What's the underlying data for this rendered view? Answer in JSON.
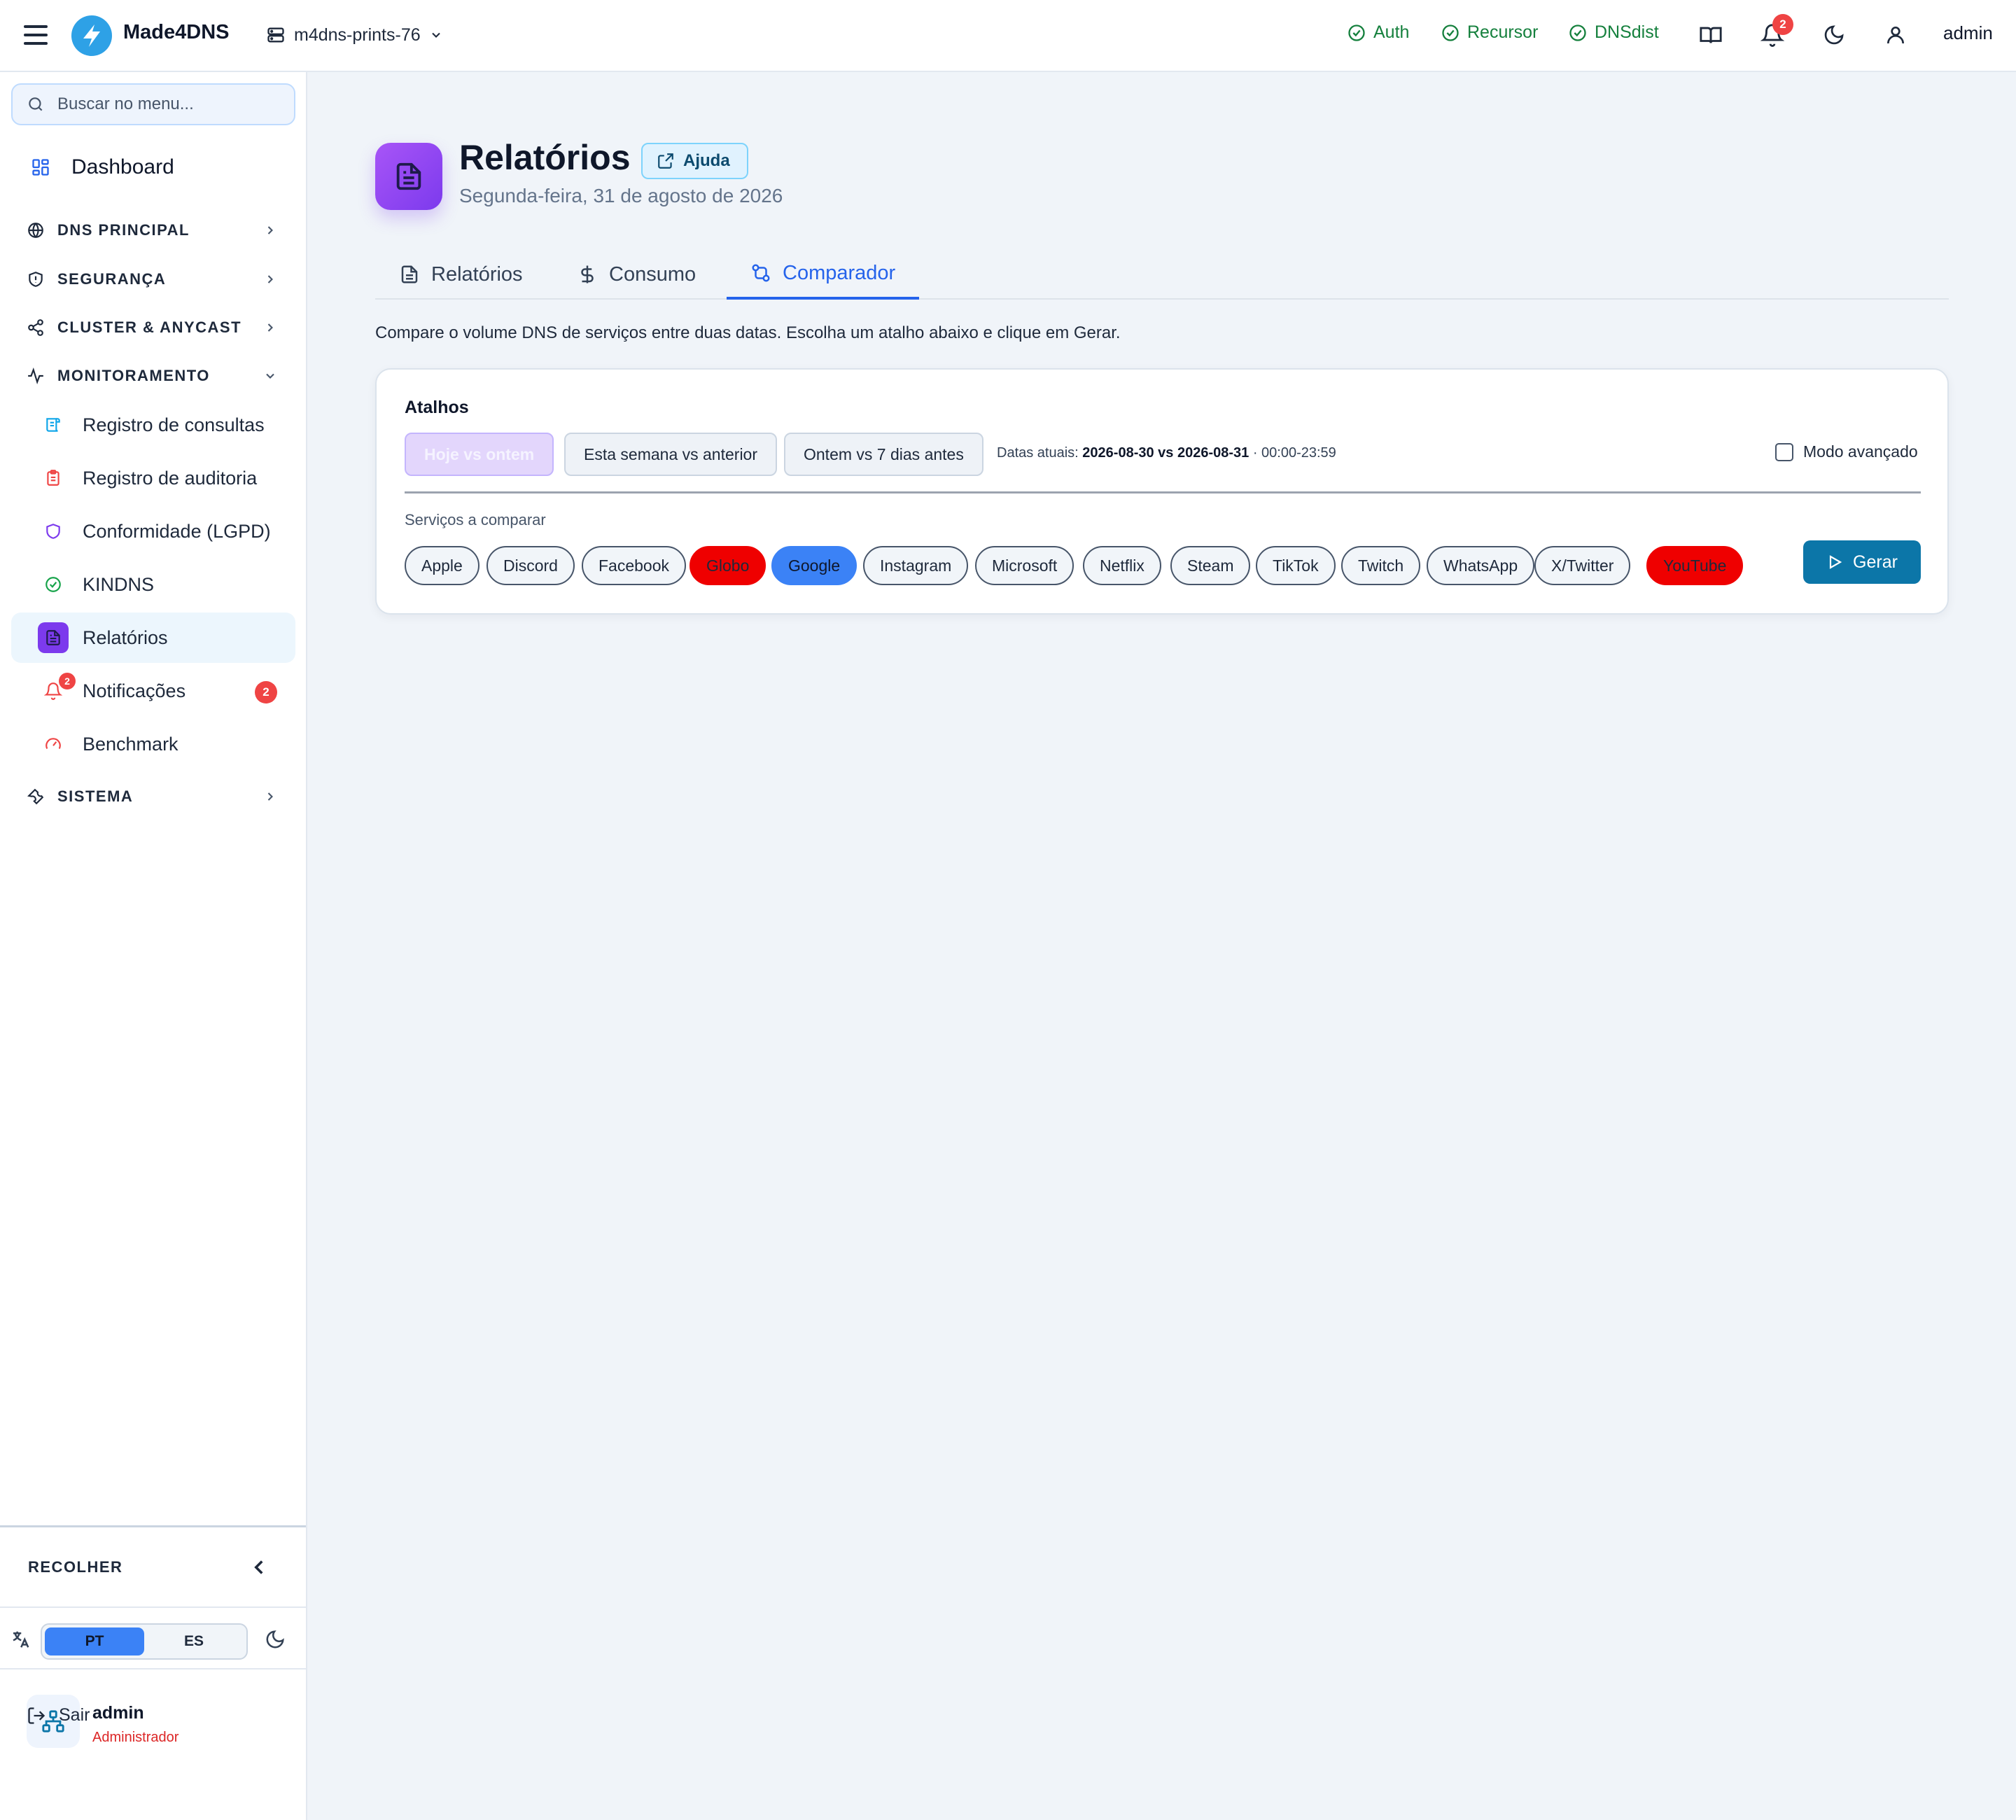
{
  "topbar": {
    "brand": "Made4DNS",
    "server": "m4dns-prints-76",
    "status": [
      {
        "label": "Auth",
        "color": "#15803d"
      },
      {
        "label": "Recursor",
        "color": "#15803d"
      },
      {
        "label": "DNSdist",
        "color": "#15803d"
      }
    ],
    "notifications_count": "2",
    "user": "admin"
  },
  "sidebar": {
    "search_placeholder": "Buscar no menu...",
    "dashboard": "Dashboard",
    "sections": [
      {
        "label": "DNS PRINCIPAL",
        "icon": "globe-icon",
        "expanded": false
      },
      {
        "label": "SEGURANÇA",
        "icon": "shield-alert-icon",
        "expanded": false
      },
      {
        "label": "CLUSTER & ANYCAST",
        "icon": "share-nodes-icon",
        "expanded": false
      },
      {
        "label": "MONITORAMENTO",
        "icon": "activity-icon",
        "expanded": true
      },
      {
        "label": "SISTEMA",
        "icon": "wrench-icon",
        "expanded": false
      }
    ],
    "monitor_items": [
      {
        "label": "Registro de consultas",
        "icon": "scroll-icon",
        "color": "#0ea5e9"
      },
      {
        "label": "Registro de auditoria",
        "icon": "clipboard-icon",
        "color": "#ef4444"
      },
      {
        "label": "Conformidade (LGPD)",
        "icon": "shield-icon",
        "color": "#7c3aed"
      },
      {
        "label": "KINDNS",
        "icon": "check-circle-icon",
        "color": "#16a34a"
      },
      {
        "label": "Relatórios",
        "icon": "file-text-icon",
        "color": "#7c3aed",
        "active": true
      },
      {
        "label": "Notificações",
        "icon": "bell-icon",
        "color": "#ef4444",
        "badge": "2"
      },
      {
        "label": "Benchmark",
        "icon": "gauge-icon",
        "color": "#ef4444"
      }
    ],
    "collapse": "RECOLHER",
    "languages": [
      "PT",
      "ES"
    ],
    "active_language": "PT",
    "user": {
      "name": "admin",
      "role": "Administrador"
    },
    "logout": "Sair"
  },
  "page": {
    "title": "Relatórios",
    "help": "Ajuda",
    "subtitle": "Segunda-feira, 31 de agosto de 2026",
    "tabs": [
      {
        "label": "Relatórios",
        "icon": "file-text-icon"
      },
      {
        "label": "Consumo",
        "icon": "dollar-icon"
      },
      {
        "label": "Comparador",
        "icon": "git-compare-icon",
        "active": true
      }
    ],
    "description": "Compare o volume DNS de serviços entre duas datas. Escolha um atalho abaixo e clique em Gerar."
  },
  "comparator": {
    "shortcuts_title": "Atalhos",
    "shortcuts": [
      "Hoje vs ontem",
      "Esta semana vs anterior",
      "Ontem vs 7 dias antes"
    ],
    "active_shortcut": "Hoje vs ontem",
    "dates_prefix": "Datas atuais:",
    "dates_value": "2026-08-30 vs 2026-08-31",
    "dates_time": "· 00:00-23:59",
    "advanced_mode": "Modo avançado",
    "advanced_checked": false,
    "services_label": "Serviços a comparar",
    "services": [
      {
        "name": "Apple",
        "state": "default"
      },
      {
        "name": "Discord",
        "state": "default"
      },
      {
        "name": "Facebook",
        "state": "default"
      },
      {
        "name": "Globo",
        "state": "red"
      },
      {
        "name": "Google",
        "state": "blue"
      },
      {
        "name": "Instagram",
        "state": "default"
      },
      {
        "name": "Microsoft",
        "state": "default"
      },
      {
        "name": "Netflix",
        "state": "default"
      },
      {
        "name": "Steam",
        "state": "default"
      },
      {
        "name": "TikTok",
        "state": "default"
      },
      {
        "name": "Twitch",
        "state": "default"
      },
      {
        "name": "WhatsApp",
        "state": "default"
      },
      {
        "name": "X/Twitter",
        "state": "default"
      },
      {
        "name": "YouTube",
        "state": "red"
      }
    ],
    "generate": "Gerar"
  }
}
